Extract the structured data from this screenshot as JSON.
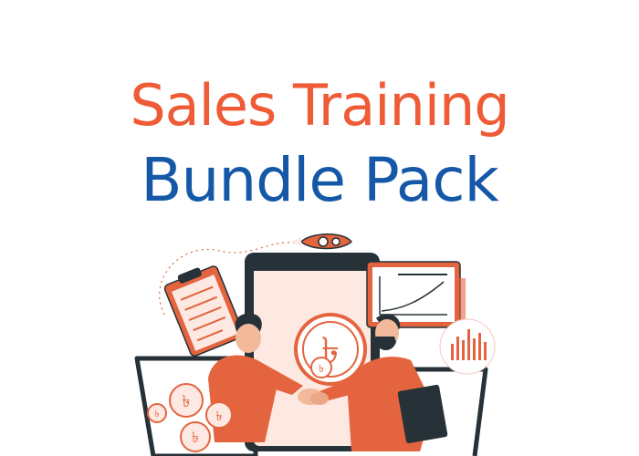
{
  "title": {
    "line1": "Sales Training",
    "line2": "Bundle Pack"
  },
  "colors": {
    "line1": "#ef5b36",
    "line2": "#1558a8",
    "accent": "#e4643f",
    "dark": "#263238",
    "pale": "#fde8e2"
  },
  "illustration": {
    "currency_symbol": "৳",
    "icons": [
      "handshake-icon",
      "rocket-icon",
      "clipboard-icon",
      "chart-board-icon",
      "bar-chart-icon",
      "laptop-icon",
      "tablet-icon",
      "coin-icon",
      "folder-icon"
    ]
  }
}
